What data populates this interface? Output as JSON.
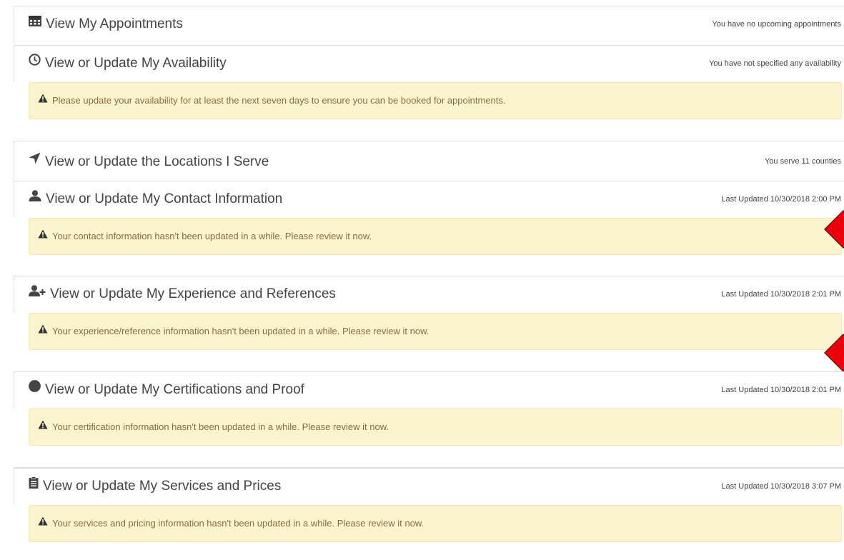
{
  "sections": [
    {
      "title": "View My Appointments",
      "icon": "calendar-icon",
      "status": "You have no upcoming appointments"
    },
    {
      "title": "View or Update My Availability",
      "icon": "clock-icon",
      "status": "You have not specified any availability",
      "alert": "Please update your availability for at least the next seven days to ensure you can be booked for appointments."
    },
    {
      "title": "View or Update the Locations I Serve",
      "icon": "location-arrow-icon",
      "status": "You serve 11 counties"
    },
    {
      "title": "View or Update My Contact Information",
      "icon": "user-icon",
      "status": "Last Updated 10/30/2018 2:00 PM",
      "alert": "Your contact information hasn't been updated in a while. Please review it now."
    },
    {
      "title": "View or Update My Experience and References",
      "icon": "user-plus-icon",
      "status": "Last Updated 10/30/2018 2:01 PM",
      "alert": "Your experience/reference information hasn't been updated in a while. Please review it now."
    },
    {
      "title": "View or Update My Certifications and Proof",
      "icon": "certificate-icon",
      "status": "Last Updated 10/30/2018 2:01 PM",
      "alert": "Your certification information hasn't been updated in a while. Please review it now."
    },
    {
      "title": "View or Update My Services and Prices",
      "icon": "clipboard-icon",
      "status": "Last Updated 10/30/2018 3:07 PM",
      "alert": "Your services and pricing information hasn't been updated in a while. Please review it now."
    }
  ],
  "colors": {
    "alert_background": "#fcf3cf",
    "alert_text": "#8a6d3b",
    "annotation_marker": "#e8000b"
  }
}
